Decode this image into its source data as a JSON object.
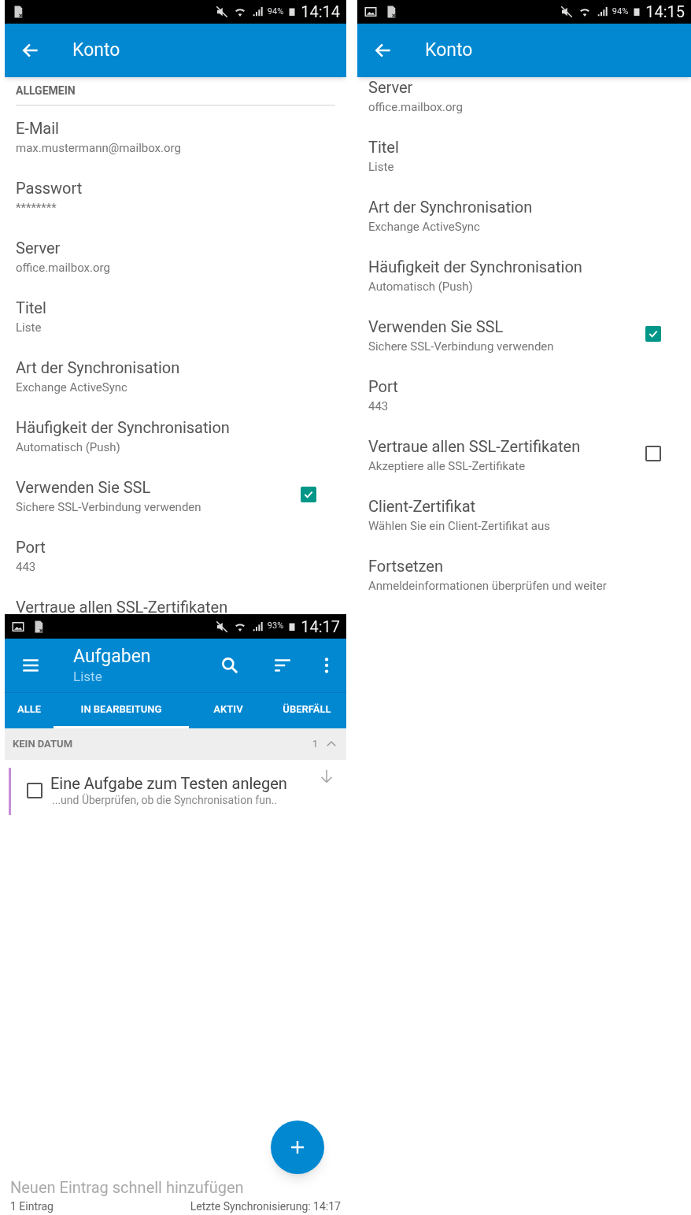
{
  "screens": [
    {
      "kind": "settings",
      "status_bar": {
        "battery": "94%",
        "time": "14:14",
        "image_icon": false
      },
      "title": "Konto",
      "section": "ALLGEMEIN",
      "items": [
        {
          "kind": "text",
          "title": "E-Mail",
          "subtitle": "max.mustermann@mailbox.org"
        },
        {
          "kind": "text",
          "title": "Passwort",
          "subtitle": "********"
        },
        {
          "kind": "text",
          "title": "Server",
          "subtitle": "office.mailbox.org"
        },
        {
          "kind": "text",
          "title": "Titel",
          "subtitle": "Liste"
        },
        {
          "kind": "text",
          "title": "Art der Synchronisation",
          "subtitle": "Exchange ActiveSync"
        },
        {
          "kind": "text",
          "title": "Häufigkeit der Synchronisation",
          "subtitle": "Automatisch (Push)"
        },
        {
          "kind": "checkbox",
          "title": "Verwenden Sie SSL",
          "subtitle": "Sichere SSL-Verbindung verwenden",
          "checked": true
        },
        {
          "kind": "text",
          "title": "Port",
          "subtitle": "443"
        },
        {
          "kind": "text",
          "title": "Vertraue allen SSL-Zertifikaten"
        }
      ]
    },
    {
      "kind": "settings",
      "status_bar": {
        "battery": "94%",
        "time": "14:15",
        "image_icon": true
      },
      "title": "Konto",
      "items": [
        {
          "kind": "text",
          "title": "Server",
          "subtitle": "office.mailbox.org"
        },
        {
          "kind": "text",
          "title": "Titel",
          "subtitle": "Liste"
        },
        {
          "kind": "text",
          "title": "Art der Synchronisation",
          "subtitle": "Exchange ActiveSync"
        },
        {
          "kind": "text",
          "title": "Häufigkeit der Synchronisation",
          "subtitle": "Automatisch (Push)"
        },
        {
          "kind": "checkbox",
          "title": "Verwenden Sie SSL",
          "subtitle": "Sichere SSL-Verbindung verwenden",
          "checked": true
        },
        {
          "kind": "text",
          "title": "Port",
          "subtitle": "443"
        },
        {
          "kind": "checkbox",
          "title": "Vertraue allen SSL-Zertifikaten",
          "subtitle": "Akzeptiere alle SSL-Zertifikate",
          "checked": false
        },
        {
          "kind": "text",
          "title": "Client-Zertifikat",
          "subtitle": "Wählen Sie ein Client-Zertifikat aus"
        },
        {
          "kind": "text",
          "title": "Fortsetzen",
          "subtitle": "Anmeldeinformationen überprüfen und weiter"
        }
      ]
    },
    {
      "kind": "tasks",
      "status_bar": {
        "battery": "93%",
        "time": "14:17",
        "image_icon": true
      },
      "title": "Aufgaben",
      "subtitle": "Liste",
      "tabs": [
        {
          "label": "ALLE",
          "selected": false
        },
        {
          "label": "IN BEARBEITUNG",
          "selected": true
        },
        {
          "label": "AKTIV",
          "selected": false
        },
        {
          "label": "ÜBERFÄLL",
          "selected": false
        }
      ],
      "group": {
        "label": "KEIN DATUM",
        "count": "1",
        "expanded": true
      },
      "tasks": [
        {
          "title": "Eine Aufgabe zum Testen anlegen",
          "note": "...und Überprüfen, ob die Synchronisation fun..",
          "checked": false,
          "color": "#c78fd6"
        }
      ],
      "quick_add": {
        "placeholder": "Neuen Eintrag schnell hinzufügen"
      },
      "footer": {
        "count": "1 Eintrag",
        "sync": "Letzte Synchronisierung: 14:17"
      }
    }
  ]
}
